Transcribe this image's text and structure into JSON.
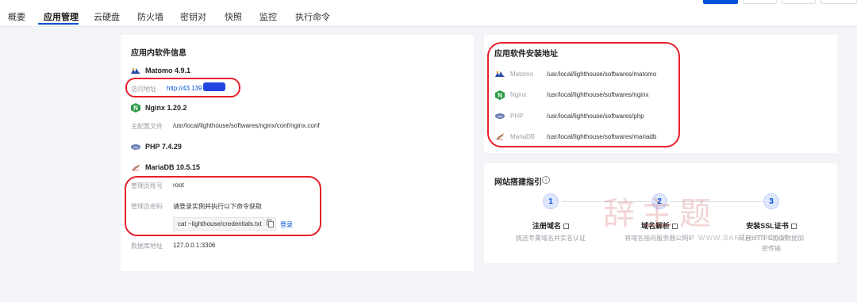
{
  "tabs": [
    {
      "label": "概要"
    },
    {
      "label": "应用管理",
      "active": true
    },
    {
      "label": "云硬盘"
    },
    {
      "label": "防火墙"
    },
    {
      "label": "密钥对"
    },
    {
      "label": "快照"
    },
    {
      "label": "监控"
    },
    {
      "label": "执行命令"
    }
  ],
  "left_card": {
    "title": "应用内软件信息",
    "apps": {
      "matomo": {
        "name": "Matomo 4.9.1",
        "access_label": "访问地址",
        "access_value": "http://43.139"
      },
      "nginx": {
        "name": "Nginx 1.20.2",
        "config_label": "主配置文件",
        "config_value": "/usr/local/lighthouse/softwares/nginx/conf/nginx.conf"
      },
      "php": {
        "name": "PHP 7.4.29"
      },
      "mariadb": {
        "name": "MariaDB 10.5.15",
        "admin_user_label": "管理员账号",
        "admin_user_value": "root",
        "admin_pwd_label": "管理员密码",
        "admin_pwd_hint": "请登录实例并执行以下命令获取",
        "command": "cat ~lighthouse/credentials.txt",
        "login_link": "登录",
        "db_addr_label": "数据库地址",
        "db_addr_value": "127.0.0.1:3306"
      }
    }
  },
  "install_card": {
    "title": "应用软件安装地址",
    "rows": [
      {
        "name": "Matomo",
        "path": "/usr/local/lighthouse/softwares/matomo",
        "icon": "matomo-icon"
      },
      {
        "name": "Nginx",
        "path": "/usr/local/lighthouse/softwares/nginx",
        "icon": "nginx-icon"
      },
      {
        "name": "PHP",
        "path": "/usr/local/lighthouse/softwares/php",
        "icon": "php-icon"
      },
      {
        "name": "MariaDB",
        "path": "/usr/local/lighthouse/softwares/mariadb",
        "icon": "mariadb-icon"
      }
    ]
  },
  "guide_card": {
    "title": "网站搭建指引",
    "steps": [
      {
        "num": "1",
        "title": "注册域名",
        "desc": "挑选专属域名并实名认证"
      },
      {
        "num": "2",
        "title": "域名解析",
        "desc": "将域名指向服务器公网IP"
      },
      {
        "num": "3",
        "title": "安装SSL证书",
        "desc": "开启HTTPS协议数据加密传输"
      }
    ]
  },
  "watermark": {
    "text": "辞主题",
    "url": "WWW.BANZHUTI.COM"
  },
  "colors": {
    "accent": "#0052d9",
    "highlight": "#e8202a",
    "background": "#f3f4f7"
  }
}
